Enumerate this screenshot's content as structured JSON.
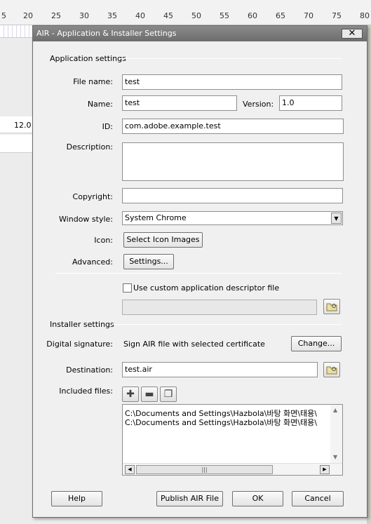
{
  "ruler": {
    "marks": [
      "5",
      "20",
      "25",
      "30",
      "35",
      "40",
      "45",
      "50",
      "55",
      "60",
      "65",
      "70",
      "75",
      "80"
    ]
  },
  "background": {
    "value": "12.0"
  },
  "dialog": {
    "title": "AIR - Application & Installer Settings",
    "close_label": "✕",
    "app_section": "Application settings",
    "file_name": {
      "label": "File name:",
      "value": "test"
    },
    "name": {
      "label": "Name:",
      "value": "test"
    },
    "version": {
      "label": "Version:",
      "value": "1.0"
    },
    "id": {
      "label": "ID:",
      "value": "com.adobe.example.test"
    },
    "description": {
      "label": "Description:",
      "value": ""
    },
    "copyright": {
      "label": "Copyright:",
      "value": ""
    },
    "window_style": {
      "label": "Window style:",
      "value": "System Chrome"
    },
    "icon": {
      "label": "Icon:",
      "button": "Select Icon Images"
    },
    "advanced": {
      "label": "Advanced:",
      "button": "Settings..."
    },
    "custom_descriptor": {
      "label": "Use custom application descriptor file",
      "checked": false,
      "path": ""
    },
    "installer_section": "Installer settings",
    "signature": {
      "label": "Digital signature:",
      "value": "Sign AIR file with selected certificate",
      "button": "Change..."
    },
    "destination": {
      "label": "Destination:",
      "value": "test.air"
    },
    "included_files": {
      "label": "Included files:",
      "items": [
        "C:\\Documents and Settings\\Hazbola\\바탕 화면\\태용\\",
        "C:\\Documents and Settings\\Hazbola\\바탕 화면\\태용\\"
      ]
    },
    "buttons": {
      "help": "Help",
      "publish": "Publish AIR File",
      "ok": "OK",
      "cancel": "Cancel"
    }
  }
}
